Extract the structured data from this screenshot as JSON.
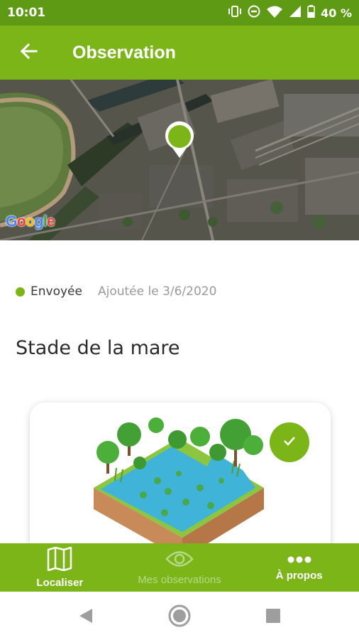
{
  "status_bar": {
    "time": "10:01",
    "battery": "40 %",
    "icons": [
      "vibrate-icon",
      "do-not-disturb-icon",
      "wifi-icon",
      "signal-icon",
      "battery-icon"
    ]
  },
  "app_bar": {
    "title": "Observation",
    "back_icon": "arrow-left-icon"
  },
  "map": {
    "attribution": "Google",
    "marker_icon": "map-pin-icon"
  },
  "observation": {
    "status": "Envoyée",
    "added": "Ajoutée le 3/6/2020",
    "title": "Stade de la mare",
    "validated_icon": "check-icon"
  },
  "bottom_nav": {
    "items": [
      {
        "label": "Localiser",
        "icon": "map-icon",
        "active": true
      },
      {
        "label": "Mes observations",
        "icon": "eye-icon",
        "active": false
      },
      {
        "label": "À propos",
        "icon": "more-icon",
        "active": true
      }
    ]
  },
  "colors": {
    "primary": "#7cb518",
    "status_bar": "#5f9a14",
    "water": "#3fb4d8",
    "soil": "#c98a5a"
  }
}
